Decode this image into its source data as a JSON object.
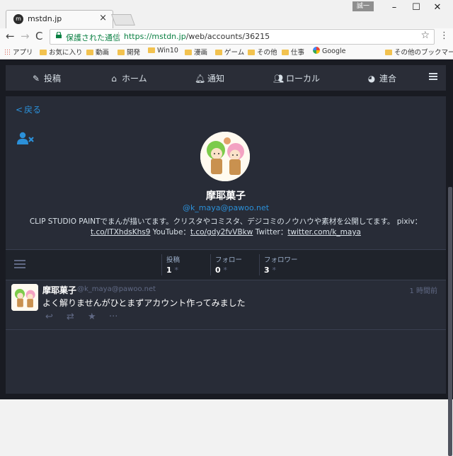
{
  "browser": {
    "tab_title": "mstdn.jp",
    "tab_favicon": "m",
    "user_badge": "誠一",
    "secure_label": "保護された通信",
    "url_host": "https://mstdn.jp",
    "url_path": "/web/accounts/36215",
    "bookmarks": [
      "アプリ",
      "お気に入り",
      "動画",
      "開発",
      "Win10",
      "漫画",
      "ゲーム",
      "その他",
      "仕事",
      "Google"
    ],
    "other_bookmarks": "その他のブックマーク"
  },
  "nav": {
    "compose": "投稿",
    "home": "ホーム",
    "notifications": "通知",
    "local": "ローカル",
    "federated": "連合"
  },
  "profile": {
    "back_label": "戻る",
    "display_name": "摩耶菓子",
    "acct": "@k_maya@pawoo.net",
    "bio_text": "CLIP STUDIO PAINTでまんが描いてます。クリスタやコミスタ、デジコミのノウハウや素材を公開してます。 pixiv：",
    "bio_link_pixiv": "t.co/ITXhdsKhs9",
    "bio_youtube_label": " YouTube：",
    "bio_link_youtube": "t.co/gdy2fvVBkw",
    "bio_twitter_label": " Twitter：",
    "bio_link_twitter": "twitter.com/k_maya",
    "counts": [
      {
        "label": "投稿",
        "value": "1"
      },
      {
        "label": "フォロー",
        "value": "0"
      },
      {
        "label": "フォロワー",
        "value": "3"
      }
    ]
  },
  "status": {
    "display_name": "摩耶菓子",
    "acct": "@k_maya@pawoo.net",
    "time": "1 時間前",
    "content": "よく解りませんがひとまずアカウント作ってみました"
  },
  "colors": {
    "accent": "#2b90d9",
    "background": "#191b22",
    "panel": "#282c37"
  }
}
